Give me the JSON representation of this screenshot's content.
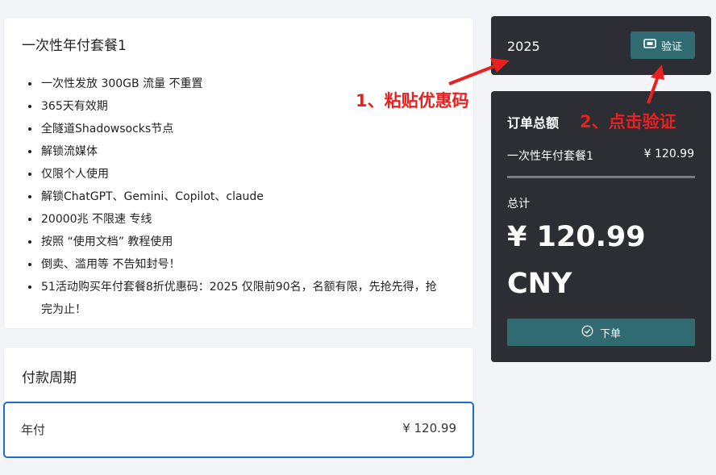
{
  "plan": {
    "title": "一次性年付套餐1",
    "features": [
      "一次性发放 300GB 流量 不重置",
      "365天有效期",
      "全隧道Shadowsocks节点",
      "解锁流媒体",
      "仅限个人使用",
      "解锁ChatGPT、Gemini、Copilot、claude",
      "20000兆 不限速 专线",
      "按照 “使用文档” 教程使用",
      "倒卖、滥用等 不告知封号！",
      "51活动购买年付套餐8折优惠码：2025 仅限前90名，名额有限，先抢先得，抢完为止！"
    ]
  },
  "period": {
    "title": "付款周期",
    "option_name": "年付",
    "option_price": "¥ 120.99"
  },
  "coupon": {
    "value": "2025",
    "verify_label": "验证",
    "verify_icon": "ticket-icon"
  },
  "summary": {
    "title": "订单总额",
    "plan_name": "一次性年付套餐1",
    "plan_price": "¥ 120.99",
    "total_label": "总计",
    "total_amount": "¥ 120.99 CNY",
    "submit_label": "下单",
    "submit_icon": "check-circle-icon"
  },
  "annotations": {
    "step1": "1、粘贴优惠码",
    "step2": "2、点击验证"
  },
  "colors": {
    "accent": "#2f6b70",
    "dark_panel": "#2c2e33",
    "selected_border": "#1e6bc9",
    "annotation": "#e8201f"
  }
}
